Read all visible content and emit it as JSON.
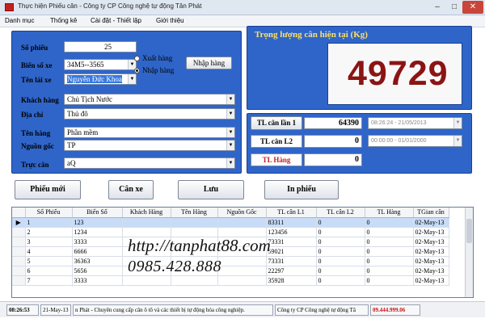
{
  "window": {
    "title": "Thực hiện Phiếu cân - Công ty CP Công nghệ tự động Tân Phát",
    "minimize": "–",
    "maximize": "□",
    "close": "✕"
  },
  "menu": {
    "items": [
      "Danh mục",
      "Thống kê",
      "Cài đặt - Thiết lập",
      "Giới thiệu"
    ]
  },
  "form": {
    "so_phieu_label": "Số phiếu",
    "so_phieu_value": "25",
    "bien_so_label": "Biển số xe",
    "bien_so_value": "34M5--3565",
    "ten_lai_xe_label": "Tên lái xe",
    "ten_lai_xe_value": "Nguyễn Đức Khoa",
    "radio_xuat": "Xuất hàng",
    "radio_nhap": "Nhập hàng",
    "nhap_hang_button": "Nhập hàng",
    "khach_hang_label": "Khách hàng",
    "khach_hang_value": "Chủ Tịch Nước",
    "dia_chi_label": "Địa chỉ",
    "dia_chi_value": "Thủ đô",
    "ten_hang_label": "Tên hàng",
    "ten_hang_value": "Phần mềm",
    "nguon_goc_label": "Nguồn gốc",
    "nguon_goc_value": "TP",
    "truc_can_label": "Trực cân",
    "truc_can_value": "aQ"
  },
  "weight": {
    "title": "Trọng lượng cân hiện tại (Kg)",
    "value": "49729"
  },
  "scale": {
    "can1_button": "TL cân lần 1",
    "can1_value": "64390",
    "can1_time": "08:26:24 - 21/05/2013",
    "can2_label": "TL cân L2",
    "can2_value": "0",
    "can2_time": "00:00:00 - 01/01/2000",
    "hang_label": "TL Hàng",
    "hang_value": "0"
  },
  "actions": {
    "phieu_moi": "Phiếu mới",
    "can_xe": "Cân xe",
    "luu": "Lưu",
    "in_phieu": "In phiếu"
  },
  "grid": {
    "columns": [
      "Số Phiếu",
      "Biển Số",
      "Khách Hàng",
      "Tên Hàng",
      "Nguồn Gốc",
      "TL cân L1",
      "TL cân L2",
      "TL Hàng",
      "TGian cân"
    ],
    "rows": [
      [
        "1",
        "123",
        "",
        "",
        "",
        "83311",
        "0",
        "0",
        "02-May-13"
      ],
      [
        "2",
        "1234",
        "",
        "",
        "",
        "123456",
        "0",
        "0",
        "02-May-13"
      ],
      [
        "3",
        "3333",
        "",
        "",
        "",
        "73331",
        "0",
        "0",
        "02-May-13"
      ],
      [
        "4",
        "6666",
        "",
        "",
        "",
        "59021",
        "0",
        "0",
        "02-May-13"
      ],
      [
        "5",
        "36363",
        "",
        "",
        "",
        "73331",
        "0",
        "0",
        "02-May-13"
      ],
      [
        "6",
        "5656",
        "",
        "",
        "",
        "22297",
        "0",
        "0",
        "02-May-13"
      ],
      [
        "7",
        "3333",
        "",
        "",
        "",
        "35928",
        "0",
        "0",
        "02-May-13"
      ]
    ]
  },
  "watermark": {
    "url": "http://tanphat88.com",
    "phone": "0985.428.888"
  },
  "status": {
    "time": "08:26:53",
    "date": "21-May-13",
    "marquee": "n Phát - Chuyên cung cấp cân ô tô và các thiết bị tự động hóa công nghiệp.",
    "company": "Công ty CP Công nghệ tự động Tâ",
    "phone": "09.444.999.06"
  },
  "colors": {
    "panel": "#2f65c9",
    "weight_digits": "#8b1414",
    "tl_hang": "#c02020",
    "status_phone": "#d01010"
  }
}
